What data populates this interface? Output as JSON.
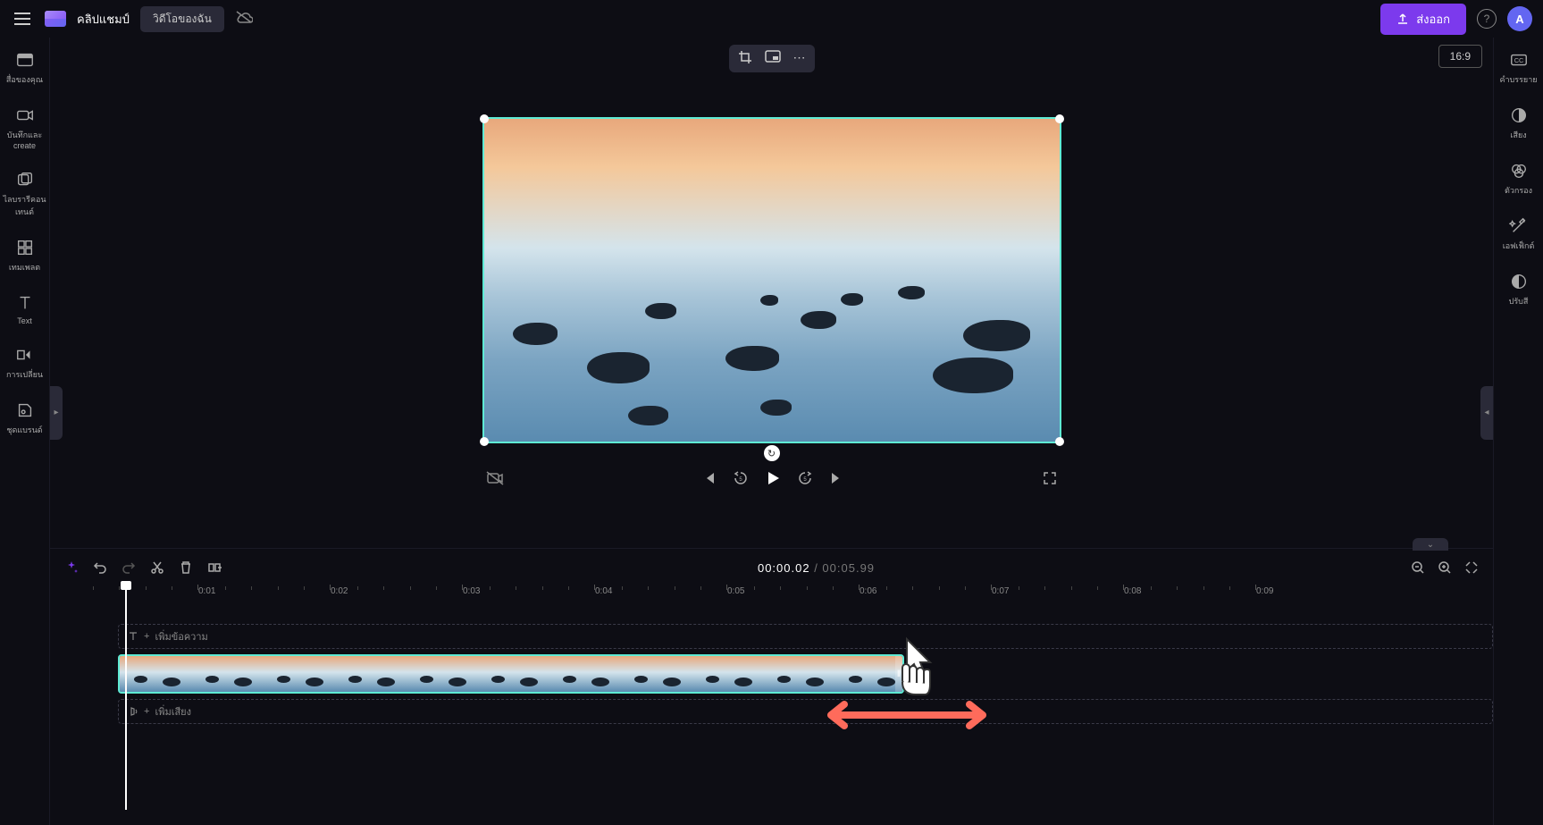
{
  "header": {
    "app_title": "คลิปแชมป์",
    "tab_my_videos": "วิดีโอของฉัน",
    "export_label": "ส่งออก",
    "avatar_letter": "A"
  },
  "left_sidebar": {
    "items": [
      {
        "label": "สื่อของคุณ"
      },
      {
        "label": "บันทึกและ\ncreate"
      },
      {
        "label": "ไลบรารีคอนเทนต์"
      },
      {
        "label": "เทมเพลต"
      },
      {
        "label": "Text"
      },
      {
        "label": "การเปลี่ยน"
      },
      {
        "label": "ชุดแบรนด์"
      }
    ]
  },
  "right_sidebar": {
    "items": [
      {
        "label": "คำบรรยาย"
      },
      {
        "label": "เสียง"
      },
      {
        "label": "ตัวกรอง"
      },
      {
        "label": "เอฟเฟ็กต์"
      },
      {
        "label": "ปรับสี"
      }
    ]
  },
  "preview": {
    "aspect_ratio": "16:9"
  },
  "timeline": {
    "current_time": "00:00.02",
    "duration": "00:05.99",
    "ruler_marks": [
      "0:01",
      "0:02",
      "0:03",
      "0:04",
      "0:05",
      "0:06",
      "0:07",
      "0:08",
      "0:09"
    ],
    "text_track_label": "เพิ่มข้อความ",
    "audio_track_label": "เพิ่มเสียง"
  }
}
